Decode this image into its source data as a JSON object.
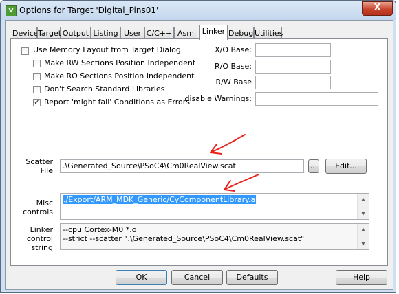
{
  "window": {
    "title": "Options for Target 'Digital_Pins01'",
    "close_glyph": "X",
    "icon_glyph": "V"
  },
  "tabs": [
    "Device",
    "Target",
    "Output",
    "Listing",
    "User",
    "C/C++",
    "Asm",
    "Linker",
    "Debug",
    "Utilities"
  ],
  "active_tab": "Linker",
  "options": {
    "use_memory_layout": {
      "label": "Use Memory Layout from Target Dialog",
      "checked": false
    },
    "rw_independent": {
      "label": "Make RW Sections Position Independent",
      "checked": false
    },
    "ro_independent": {
      "label": "Make RO Sections Position Independent",
      "checked": false
    },
    "dont_search_std_libs": {
      "label": "Don't Search Standard Libraries",
      "checked": false
    },
    "might_fail_errors": {
      "label": "Report 'might fail' Conditions as Errors",
      "checked": true
    }
  },
  "bases": {
    "xo_label": "X/O Base:",
    "xo_value": "",
    "ro_label": "R/O Base:",
    "ro_value": "",
    "rw_label": "R/W Base",
    "rw_value": "",
    "warn_label": "disable Warnings:",
    "warn_value": ""
  },
  "scatter": {
    "label_line1": "Scatter",
    "label_line2": "File",
    "value": ".\\Generated_Source\\PSoC4\\Cm0RealView.scat",
    "browse_label": "...",
    "edit_label": "Edit..."
  },
  "misc": {
    "label_line1": "Misc",
    "label_line2": "controls",
    "value": "./Export/ARM_MDK_Generic/CyComponentLibrary.a"
  },
  "linker_control": {
    "label_line1": "Linker",
    "label_line2": "control",
    "label_line3": "string",
    "line1": "--cpu Cortex-M0 *.o",
    "line2": "--strict --scatter \".\\Generated_Source\\PSoC4\\Cm0RealView.scat\""
  },
  "buttons": {
    "ok": "OK",
    "cancel": "Cancel",
    "defaults": "Defaults",
    "help": "Help"
  },
  "annotation_color": "#e8231c"
}
